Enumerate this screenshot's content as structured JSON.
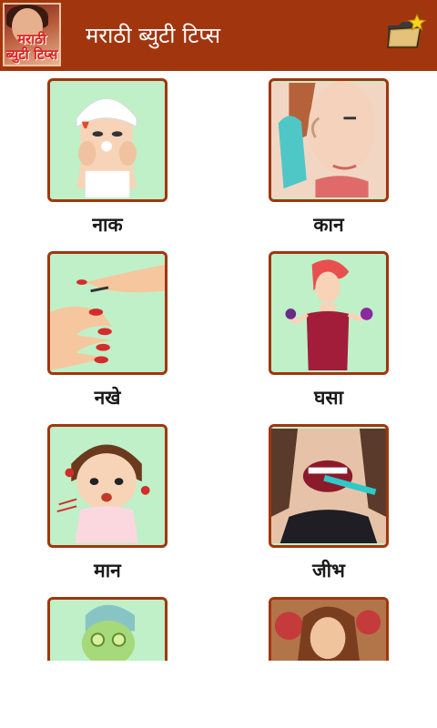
{
  "app": {
    "title": "मराठी ब्युटी टिप्स",
    "logo_text": "मराठी ब्युटी टिप्स",
    "brand_color": "#a1360e",
    "folder_icon": "folder-star-icon"
  },
  "items": [
    {
      "label": "नाक"
    },
    {
      "label": "कान"
    },
    {
      "label": "नखे"
    },
    {
      "label": "घसा"
    },
    {
      "label": "मान"
    },
    {
      "label": "जीभ"
    },
    {
      "label": ""
    },
    {
      "label": ""
    }
  ]
}
